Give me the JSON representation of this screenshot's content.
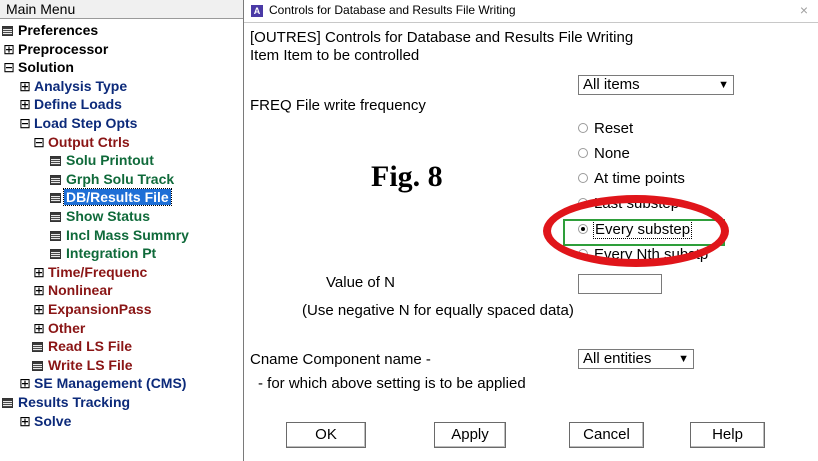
{
  "left_panel": {
    "title": "Main Menu",
    "tree": [
      {
        "label": "Preferences",
        "toggle": "",
        "icon": "book",
        "color": "blk",
        "indent": 0
      },
      {
        "label": "Preprocessor",
        "toggle": "⊞",
        "icon": "",
        "color": "blk",
        "indent": 0
      },
      {
        "label": "Solution",
        "toggle": "⊟",
        "icon": "",
        "color": "blk",
        "indent": 0
      },
      {
        "label": "Analysis Type",
        "toggle": "⊞",
        "icon": "",
        "color": "navy",
        "indent": 1
      },
      {
        "label": "Define Loads",
        "toggle": "⊞",
        "icon": "",
        "color": "navy",
        "indent": 1
      },
      {
        "label": "Load Step Opts",
        "toggle": "⊟",
        "icon": "",
        "color": "navy",
        "indent": 1
      },
      {
        "label": "Output Ctrls",
        "toggle": "⊟",
        "icon": "",
        "color": "red",
        "indent": 2
      },
      {
        "label": "Solu Printout",
        "toggle": "",
        "icon": "book",
        "color": "green",
        "indent": 3
      },
      {
        "label": "Grph Solu Track",
        "toggle": "",
        "icon": "book",
        "color": "green",
        "indent": 3
      },
      {
        "label": "DB/Results File",
        "toggle": "",
        "icon": "book",
        "color": "green",
        "indent": 3,
        "selected": true
      },
      {
        "label": "Show Status",
        "toggle": "",
        "icon": "book",
        "color": "green",
        "indent": 3
      },
      {
        "label": "Incl Mass Summry",
        "toggle": "",
        "icon": "book",
        "color": "green",
        "indent": 3
      },
      {
        "label": "Integration Pt",
        "toggle": "",
        "icon": "book",
        "color": "green",
        "indent": 3
      },
      {
        "label": "Time/Frequenc",
        "toggle": "⊞",
        "icon": "",
        "color": "red",
        "indent": 2
      },
      {
        "label": "Nonlinear",
        "toggle": "⊞",
        "icon": "",
        "color": "red",
        "indent": 2
      },
      {
        "label": "ExpansionPass",
        "toggle": "⊞",
        "icon": "",
        "color": "red",
        "indent": 2
      },
      {
        "label": "Other",
        "toggle": "⊞",
        "icon": "",
        "color": "red",
        "indent": 2
      },
      {
        "label": "Read LS File",
        "toggle": "",
        "icon": "book",
        "color": "red",
        "indent": 2
      },
      {
        "label": "Write LS File",
        "toggle": "",
        "icon": "book",
        "color": "red",
        "indent": 2
      },
      {
        "label": "SE Management (CMS)",
        "toggle": "⊞",
        "icon": "",
        "color": "navy",
        "indent": 1
      },
      {
        "label": "Results Tracking",
        "toggle": "",
        "icon": "book",
        "color": "navy",
        "indent": 0
      },
      {
        "label": "Solve",
        "toggle": "⊞",
        "icon": "",
        "color": "navy",
        "indent": 1
      }
    ]
  },
  "dialog": {
    "title": "Controls for Database and Results File Writing",
    "close_glyph": "×",
    "app_icon_letter": "A",
    "heading": "[OUTRES] Controls for Database and Results File Writing",
    "item_label": "Item  Item to be controlled",
    "item_value": "All items",
    "freq_label": "FREQ  File write frequency",
    "options": [
      "Reset",
      "None",
      "At time points",
      "Last substep",
      "Every substep",
      "Every Nth substp"
    ],
    "selected_option": "Every substep",
    "n_label": "Value of N",
    "n_note": "(Use negative N for equally spaced data)",
    "n_value": "",
    "cname_label": "Cname  Component name -",
    "cname_value": "All entities",
    "cname_note": "- for which above setting is to be applied",
    "buttons": {
      "ok": "OK",
      "apply": "Apply",
      "cancel": "Cancel",
      "help": "Help"
    }
  },
  "annotation": {
    "fig_label": "Fig. 8",
    "ellipse_color": "#e0151a",
    "highlight_color": "#2e9e3a"
  }
}
